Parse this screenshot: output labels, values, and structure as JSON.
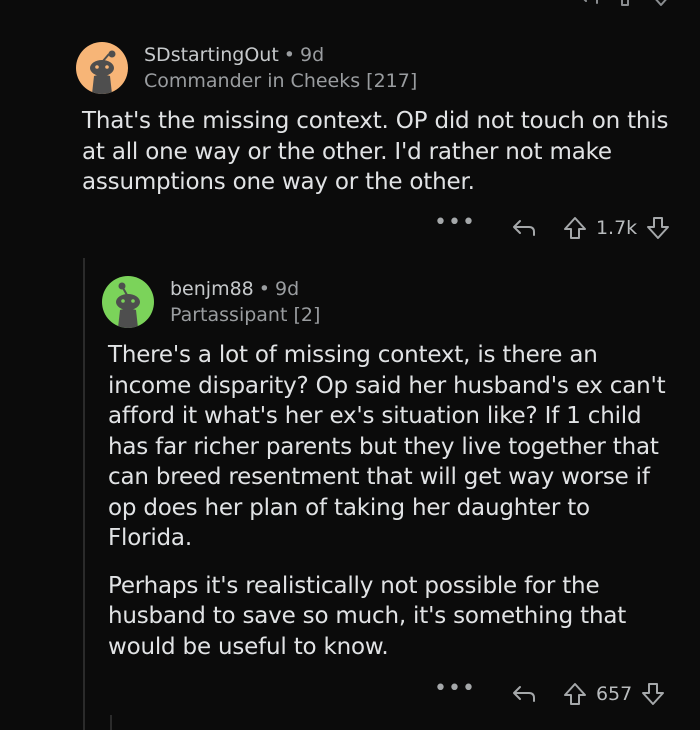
{
  "comments": [
    {
      "username": "SDstartingOut",
      "age": "9d",
      "flair": "Commander in Cheeks [217]",
      "avatar_color": "#f7b577",
      "paragraphs": [
        "That's the missing context.  OP did not touch on this at all one way or the other.  I'd rather not make assumptions one way or the other."
      ],
      "more_label": "•••",
      "votes": "1.7k"
    },
    {
      "username": "benjm88",
      "age": "9d",
      "flair": "Partassipant [2]",
      "avatar_color": "#7bd35a",
      "paragraphs": [
        "There's a lot of missing context, is there an income disparity? Op said her husband's ex can't afford it what's her ex's situation like? If 1 child has far richer parents but they live together that can breed resentment that will get way worse if op does her plan of taking her daughter to Florida.",
        "Perhaps it's realistically not possible for the husband to save so much, it's something that would be useful to know."
      ],
      "more_label": "•••",
      "votes": "657"
    }
  ],
  "separator": "•",
  "icons": {
    "reply": "reply-icon",
    "upvote": "upvote-arrow-icon",
    "downvote": "downvote-arrow-icon",
    "more": "more-options-icon"
  }
}
